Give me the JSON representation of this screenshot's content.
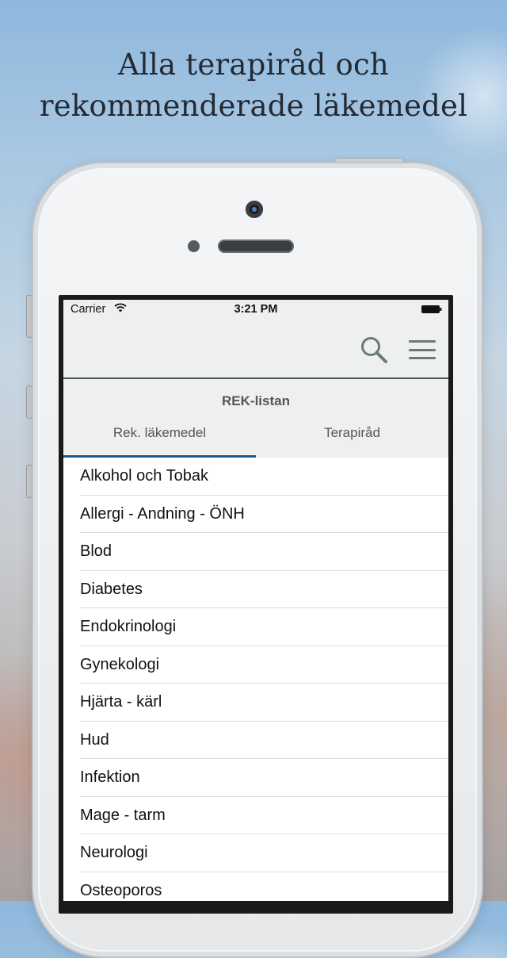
{
  "headline": {
    "line1": "Alla terapiråd och",
    "line2": "rekommenderade läkemedel"
  },
  "status_bar": {
    "carrier": "Carrier",
    "time": "3:21 PM"
  },
  "nav_bar": {
    "icons": [
      "search-icon",
      "menu-icon"
    ]
  },
  "section": {
    "title": "REK-listan",
    "tabs": [
      {
        "label": "Rek. läkemedel",
        "selected": true
      },
      {
        "label": "Terapiråd",
        "selected": false
      }
    ]
  },
  "list": {
    "items": [
      "Alkohol och Tobak",
      "Allergi - Andning - ÖNH",
      "Blod",
      "Diabetes",
      "Endokrinologi",
      "Gynekologi",
      "Hjärta - kärl",
      "Hud",
      "Infektion",
      "Mage - tarm",
      "Neurologi",
      "Osteoporos"
    ]
  },
  "colors": {
    "tab_indicator": "#1b5d93",
    "nav_icon": "#6a7a7a",
    "header_background": "#eef0ef"
  }
}
